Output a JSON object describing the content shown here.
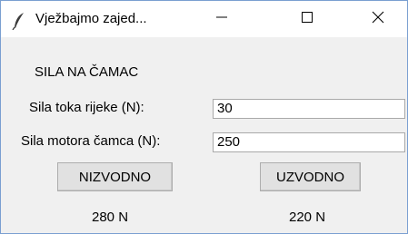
{
  "window": {
    "title": "Vježbajmo zajed..."
  },
  "form": {
    "heading": "SILA NA ČAMAC",
    "river_label": "Sila toka rijeke (N):",
    "river_value": "30",
    "motor_label": "Sila motora čamca (N):",
    "motor_value": "250"
  },
  "buttons": {
    "downstream_label": "NIZVODNO",
    "upstream_label": "UZVODNO"
  },
  "results": {
    "downstream": "280 N",
    "upstream": "220 N"
  },
  "icons": {
    "app": "feather-icon",
    "minimize": "minimize-icon",
    "maximize": "maximize-icon",
    "close": "close-icon"
  }
}
